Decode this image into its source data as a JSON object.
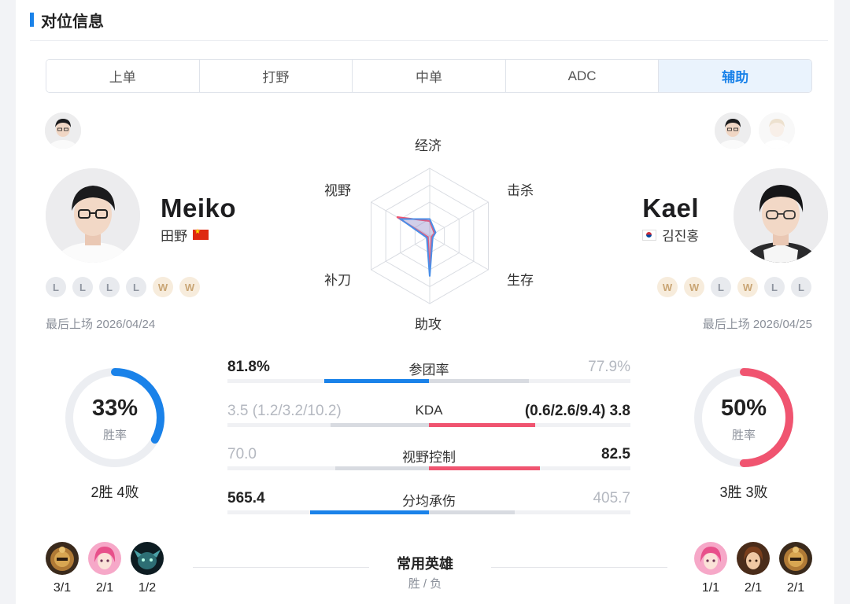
{
  "section": {
    "title": "对位信息"
  },
  "tabs": [
    {
      "label": "上单",
      "active": false
    },
    {
      "label": "打野",
      "active": false
    },
    {
      "label": "中单",
      "active": false
    },
    {
      "label": "ADC",
      "active": false
    },
    {
      "label": "辅助",
      "active": true
    }
  ],
  "left_player": {
    "name": "Meiko",
    "real_name": "田野",
    "flag": "china-flag-icon",
    "results": [
      "L",
      "L",
      "L",
      "L",
      "W",
      "W"
    ],
    "last_played": "最后上场 2026/04/24",
    "win_rate": "33%",
    "win_rate_value": 33,
    "win_rate_label": "胜率",
    "record": "2胜 4败",
    "champions": [
      {
        "icon": "champion-bronze-helmet-icon",
        "record": "3/1"
      },
      {
        "icon": "champion-pink-hair-icon",
        "record": "2/1"
      },
      {
        "icon": "champion-teal-creature-icon",
        "record": "1/2"
      }
    ]
  },
  "right_player": {
    "name": "Kael",
    "real_name": "김진홍",
    "flag": "korea-flag-icon",
    "results": [
      "W",
      "W",
      "L",
      "W",
      "L",
      "L"
    ],
    "last_played": "最后上场 2026/04/25",
    "win_rate": "50%",
    "win_rate_value": 50,
    "win_rate_label": "胜率",
    "record": "3胜 3败",
    "champions": [
      {
        "icon": "champion-pink-hair-icon",
        "record": "1/1"
      },
      {
        "icon": "champion-brown-hair-icon",
        "record": "2/1"
      },
      {
        "icon": "champion-bronze-helmet-icon",
        "record": "2/1"
      }
    ]
  },
  "radar": {
    "labels": [
      "经济",
      "击杀",
      "生存",
      "助攻",
      "补刀",
      "视野"
    ],
    "left_values": [
      0.25,
      0.1,
      0.05,
      0.6,
      0.05,
      0.5
    ],
    "right_values": [
      0.22,
      0.08,
      0.03,
      0.55,
      0.03,
      0.56
    ],
    "colors": {
      "left": "#4a8fe8",
      "right": "#f05470",
      "fill": "rgba(140,130,200,0.22)"
    }
  },
  "stats": [
    {
      "name": "参团率",
      "left": "81.8%",
      "right": "77.9%",
      "left_value": 81.8,
      "right_value": 77.9,
      "winner": "left"
    },
    {
      "name": "KDA",
      "left": "3.5 (1.2/3.2/10.2)",
      "right": "(0.6/2.6/9.4) 3.8",
      "left_value": 3.5,
      "right_value": 3.8,
      "winner": "right"
    },
    {
      "name": "视野控制",
      "left": "70.0",
      "right": "82.5",
      "left_value": 70.0,
      "right_value": 82.5,
      "winner": "right"
    },
    {
      "name": "分均承伤",
      "left": "565.4",
      "right": "405.7",
      "left_value": 565.4,
      "right_value": 405.7,
      "winner": "left"
    }
  ],
  "common_heroes": {
    "title": "常用英雄",
    "subtitle": "胜 / 负"
  },
  "colors": {
    "blue": "#1a82e9",
    "red": "#f05470",
    "gray_bar": "#d8dbe1"
  }
}
